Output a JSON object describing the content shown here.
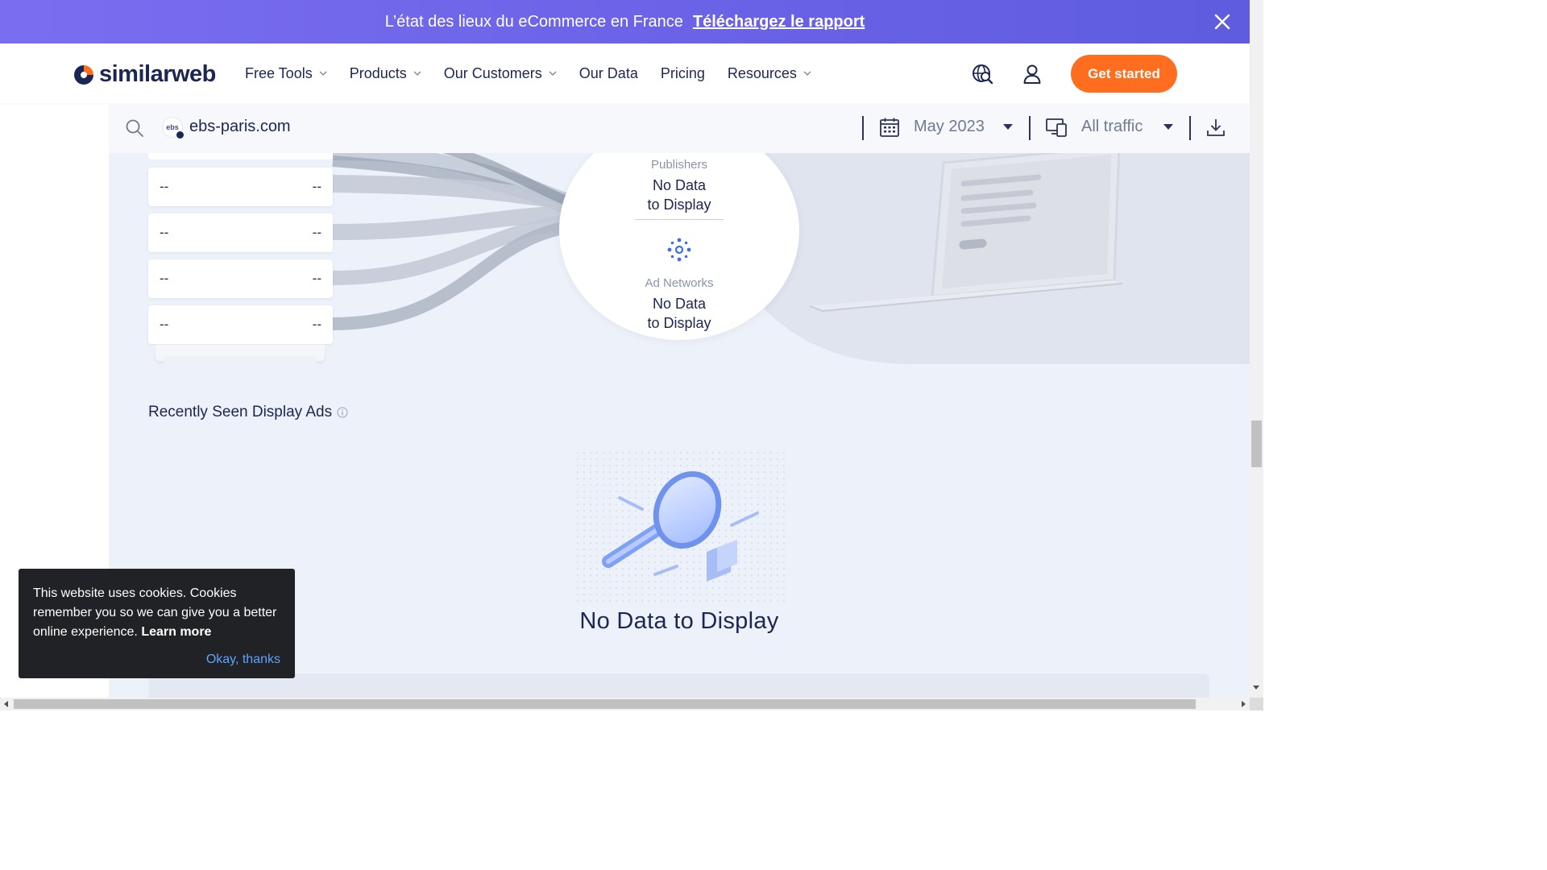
{
  "banner": {
    "message": "L’état des lieux du eCommerce en France",
    "cta": "Téléchargez le rapport"
  },
  "header": {
    "logo_text": "similarweb",
    "nav": [
      {
        "label": "Free Tools",
        "has_dropdown": true
      },
      {
        "label": "Products",
        "has_dropdown": true
      },
      {
        "label": "Our Customers",
        "has_dropdown": true
      },
      {
        "label": "Our Data",
        "has_dropdown": false
      },
      {
        "label": "Pricing",
        "has_dropdown": false
      },
      {
        "label": "Resources",
        "has_dropdown": true
      }
    ],
    "cta": "Get started",
    "icons": [
      "globe-search-icon",
      "user-icon"
    ]
  },
  "search": {
    "domain": "ebs-paris.com",
    "favicon_text": "ebs",
    "date": "May 2023",
    "traffic": "All traffic"
  },
  "flow": {
    "rows": [
      {
        "left": "--",
        "right": "--"
      },
      {
        "left": "--",
        "right": "--"
      },
      {
        "left": "--",
        "right": "--"
      },
      {
        "left": "--",
        "right": "--"
      }
    ],
    "publishers_label": "Publishers",
    "publishers_value_line1": "No Data",
    "publishers_value_line2": "to Display",
    "adnetworks_label": "Ad Networks",
    "adnetworks_value_line1": "No Data",
    "adnetworks_value_line2": "to Display"
  },
  "recent_ads": {
    "title": "Recently Seen Display Ads",
    "empty_text": "No Data to Display"
  },
  "cookie": {
    "text": "This website uses cookies. Cookies remember you so we can give you a better online experience.",
    "learn_more": "Learn more",
    "accept": "Okay, thanks"
  },
  "colors": {
    "banner": "#6c63e8",
    "accent": "#ff6e1f",
    "navy": "#1b2653",
    "link_blue": "#5ca4ff"
  }
}
